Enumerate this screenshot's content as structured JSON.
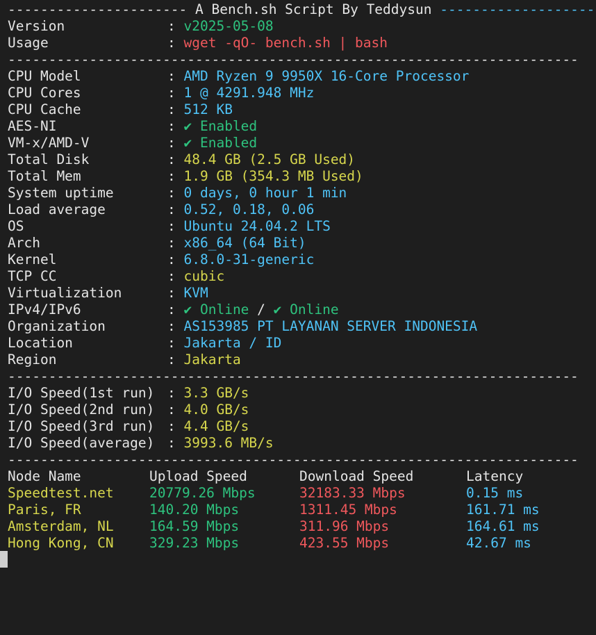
{
  "header": {
    "left_dashes": "----------------------",
    "title": "A Bench.sh Script By Teddysun",
    "right_dashes": "-------------------"
  },
  "separator": "----------------------------------------------------------------------",
  "colon": ":",
  "usage_block": [
    {
      "key": "Version",
      "value": "v2025-05-08"
    },
    {
      "key": "Usage",
      "value": "wget -qO- bench.sh | bash"
    }
  ],
  "system_info": [
    {
      "key": "CPU Model",
      "value": "AMD Ryzen 9 9950X 16-Core Processor"
    },
    {
      "key": "CPU Cores",
      "value": "1 @ 4291.948 MHz"
    },
    {
      "key": "CPU Cache",
      "value": "512 KB"
    },
    {
      "key": "AES-NI",
      "value": "✔ Enabled"
    },
    {
      "key": "VM-x/AMD-V",
      "value": "✔ Enabled"
    },
    {
      "key": "Total Disk",
      "value": "48.4 GB (2.5 GB Used)"
    },
    {
      "key": "Total Mem",
      "value": "1.9 GB (354.3 MB Used)"
    },
    {
      "key": "System uptime",
      "value": "0 days, 0 hour 1 min"
    },
    {
      "key": "Load average",
      "value": "0.52, 0.18, 0.06"
    },
    {
      "key": "OS",
      "value": "Ubuntu 24.04.2 LTS"
    },
    {
      "key": "Arch",
      "value": "x86_64 (64 Bit)"
    },
    {
      "key": "Kernel",
      "value": "6.8.0-31-generic"
    },
    {
      "key": "TCP CC",
      "value": "cubic"
    },
    {
      "key": "Virtualization",
      "value": "KVM"
    },
    {
      "key": "IPv4/IPv6",
      "value_v4": "✔ Online",
      "slash": "/",
      "value_v6": "✔ Online"
    },
    {
      "key": "Organization",
      "value": "AS153985 PT LAYANAN SERVER INDONESIA"
    },
    {
      "key": "Location",
      "value": "Jakarta / ID"
    },
    {
      "key": "Region",
      "value": "Jakarta"
    }
  ],
  "io_speed": [
    {
      "key": "I/O Speed(1st run)",
      "value": "3.3 GB/s"
    },
    {
      "key": "I/O Speed(2nd run)",
      "value": "4.0 GB/s"
    },
    {
      "key": "I/O Speed(3rd run)",
      "value": "4.4 GB/s"
    },
    {
      "key": "I/O Speed(average)",
      "value": "3993.6 MB/s"
    }
  ],
  "speedtest": {
    "headers": [
      "Node Name",
      "Upload Speed",
      "Download Speed",
      "Latency"
    ],
    "rows": [
      {
        "node": "Speedtest.net",
        "upload": "20779.26 Mbps",
        "download": "32183.33 Mbps",
        "latency": "0.15 ms"
      },
      {
        "node": "Paris, FR",
        "upload": "140.20 Mbps",
        "download": "1311.45 Mbps",
        "latency": "161.71 ms"
      },
      {
        "node": "Amsterdam, NL",
        "upload": "164.59 Mbps",
        "download": "311.96 Mbps",
        "latency": "164.61 ms"
      },
      {
        "node": "Hong Kong, CN",
        "upload": "329.23 Mbps",
        "download": "423.55 Mbps",
        "latency": "42.67 ms"
      }
    ]
  },
  "colors": {
    "background": "#1e1e1e",
    "text": "#e5e5e5",
    "blue": "#4fc3f7",
    "yellow": "#d7d74d",
    "red": "#f0585c",
    "green": "#2ec27e"
  }
}
